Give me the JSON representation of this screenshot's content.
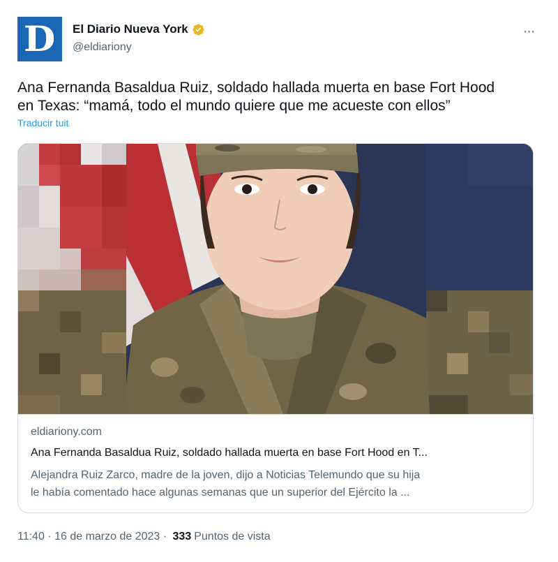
{
  "account": {
    "display_name": "El Diario Nueva York",
    "handle": "@eldiariony",
    "avatar_letter": "D",
    "avatar_color": "#1a66b5",
    "verified_badge_color": "#e8b829"
  },
  "menu": {
    "more_label": "···"
  },
  "tweet": {
    "text_line1": "Ana Fernanda Basaldua Ruiz, soldado hallada muerta en base Fort Hood",
    "text_line2": "en Texas: “mamá, todo el mundo quiere que me acueste con ellos”",
    "translate_label": "Traducir tuit"
  },
  "card": {
    "domain": "eldiariony.com",
    "title": "Ana Fernanda Basaldua Ruiz, soldado hallada muerta en base Fort Hood en T...",
    "description_line1": "Alejandra Ruiz Zarco, madre de la joven, dijo a Noticias Telemundo que su hija",
    "description_line2": "le había comentado hace algunas semanas que un superior del Ejército la ..."
  },
  "meta": {
    "time": "11:40",
    "separator1": " · ",
    "date": "16 de marzo de 2023",
    "separator2": " · ",
    "views_count": "333",
    "views_label": "Puntos de vista"
  },
  "colors": {
    "text_primary": "#0f1419",
    "text_secondary": "#536471",
    "link": "#1d9bf0",
    "border": "#cfd9de"
  }
}
